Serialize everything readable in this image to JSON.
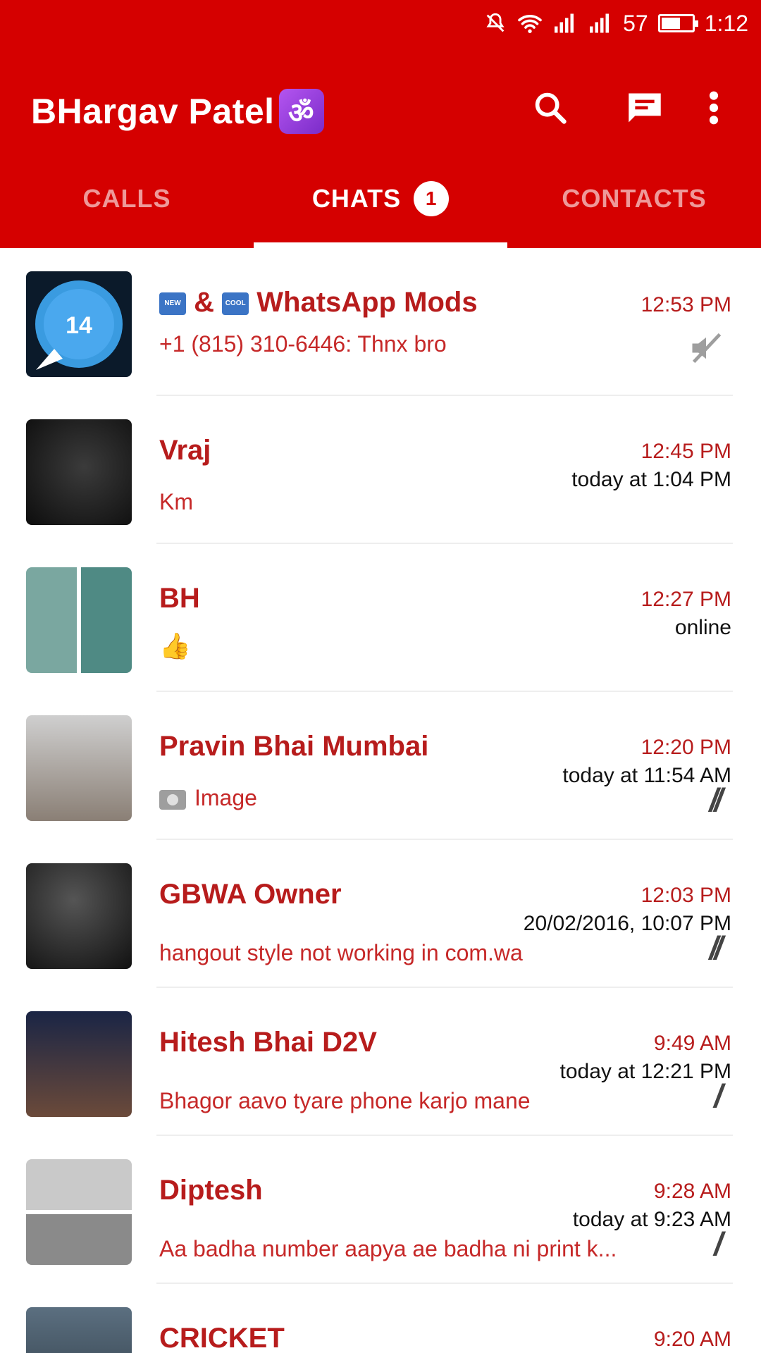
{
  "status_bar": {
    "battery": "57",
    "time": "1:12"
  },
  "header": {
    "title": "BHargav Patel",
    "badge_glyph": "ॐ"
  },
  "icons": {
    "search": "search-icon",
    "new_chat": "new-chat-icon",
    "overflow": "more-vert-icon"
  },
  "tabs": [
    {
      "label": "CALLS",
      "active": false
    },
    {
      "label": "CHATS",
      "active": true,
      "badge": "1"
    },
    {
      "label": "CONTACTS",
      "active": false
    }
  ],
  "colors": {
    "primary": "#d50000",
    "accent_text": "#b71c1c"
  },
  "chats": [
    {
      "name_prefix": "&",
      "name": "WhatsApp Mods",
      "time": "12:53 PM",
      "status": "",
      "message": "+1 (815) 310-6446: Thnx bro",
      "muted": true,
      "avatar_text": "14"
    },
    {
      "name": "Vraj",
      "time": "12:45 PM",
      "status": "today at 1:04 PM",
      "message": "Km"
    },
    {
      "name": "BH",
      "time": "12:27 PM",
      "status": "online",
      "message": "👍"
    },
    {
      "name": "Pravin Bhai Mumbai",
      "time": "12:20 PM",
      "status": "today at 11:54 AM",
      "message": "Image",
      "ticks": "//"
    },
    {
      "name": "GBWA Owner",
      "time": "12:03 PM",
      "status": "20/02/2016, 10:07 PM",
      "message": "hangout style not working in com.wa",
      "ticks": "//"
    },
    {
      "name": "Hitesh Bhai D2V",
      "time": "9:49 AM",
      "status": "today at 12:21 PM",
      "message": "Bhagor aavo tyare phone karjo mane",
      "ticks": "/"
    },
    {
      "name": "Diptesh",
      "time": "9:28 AM",
      "status": "today at 9:23 AM",
      "message": "Aa badha number aapya ae badha ni print k...",
      "ticks": "/"
    },
    {
      "name": "CRICKET",
      "time": "9:20 AM",
      "status": "",
      "message": ""
    }
  ]
}
